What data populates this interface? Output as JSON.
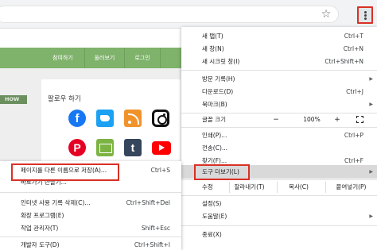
{
  "browser": {
    "star_icon": "star-icon",
    "menu_icon": "three-dot-menu-icon"
  },
  "page": {
    "nav_items": [
      "참여하기",
      "둘러보기",
      "로그인"
    ],
    "section_badge": "HOW",
    "follow_title": "팔로우 하기",
    "social_icons": [
      "facebook-icon",
      "twitter-icon",
      "rss-icon",
      "instagram-icon",
      "pinterest-icon",
      "mail-icon",
      "tumblr-icon",
      "youtube-icon"
    ],
    "social_glyphs": {
      "facebook": "f",
      "pinterest": "P",
      "tumblr": "t"
    }
  },
  "main_menu": {
    "new_tab": {
      "label": "새 탭(T)",
      "shortcut": "Ctrl+T"
    },
    "new_window": {
      "label": "새 창(N)",
      "shortcut": "Ctrl+N"
    },
    "new_incognito": {
      "label": "새 시크릿 창(I)",
      "shortcut": "Ctrl+Shift+N"
    },
    "history": {
      "label": "방문 기록(H)"
    },
    "downloads": {
      "label": "다운로드(D)",
      "shortcut": "Ctrl+J"
    },
    "bookmarks": {
      "label": "북마크(B)"
    },
    "zoom": {
      "label": "글꼴 크기",
      "minus": "−",
      "value": "100%",
      "plus": "+",
      "fullscreen_icon": "fullscreen-icon"
    },
    "print": {
      "label": "인쇄(P)...",
      "shortcut": "Ctrl+P"
    },
    "cast": {
      "label": "전송(C)..."
    },
    "find": {
      "label": "찾기(F)...",
      "shortcut": "Ctrl+F"
    },
    "more_tools": {
      "label": "도구 더보기(L)"
    },
    "edit": {
      "label": "수정",
      "cut": "잘라내기(T)",
      "copy": "복사(C)",
      "paste": "붙여넣기(P)"
    },
    "settings": {
      "label": "설정(S)"
    },
    "help": {
      "label": "도움말(E)"
    },
    "exit": {
      "label": "종료(X)"
    }
  },
  "sub_menu": {
    "save_page": {
      "label": "페이지를 다른 이름으로 저장(A)...",
      "shortcut": "Ctrl+S"
    },
    "shortcut": {
      "label": "바로가기 만들기..."
    },
    "clear_data": {
      "label": "인터넷 사용 기록 삭제(C)...",
      "shortcut": "Ctrl+Shift+Del"
    },
    "extensions": {
      "label": "확장 프로그램(E)"
    },
    "task_manager": {
      "label": "작업 관리자(T)",
      "shortcut": "Shift+Esc"
    },
    "dev_tools": {
      "label": "개발자 도구(D)",
      "shortcut": "Ctrl+Shift+I"
    }
  }
}
